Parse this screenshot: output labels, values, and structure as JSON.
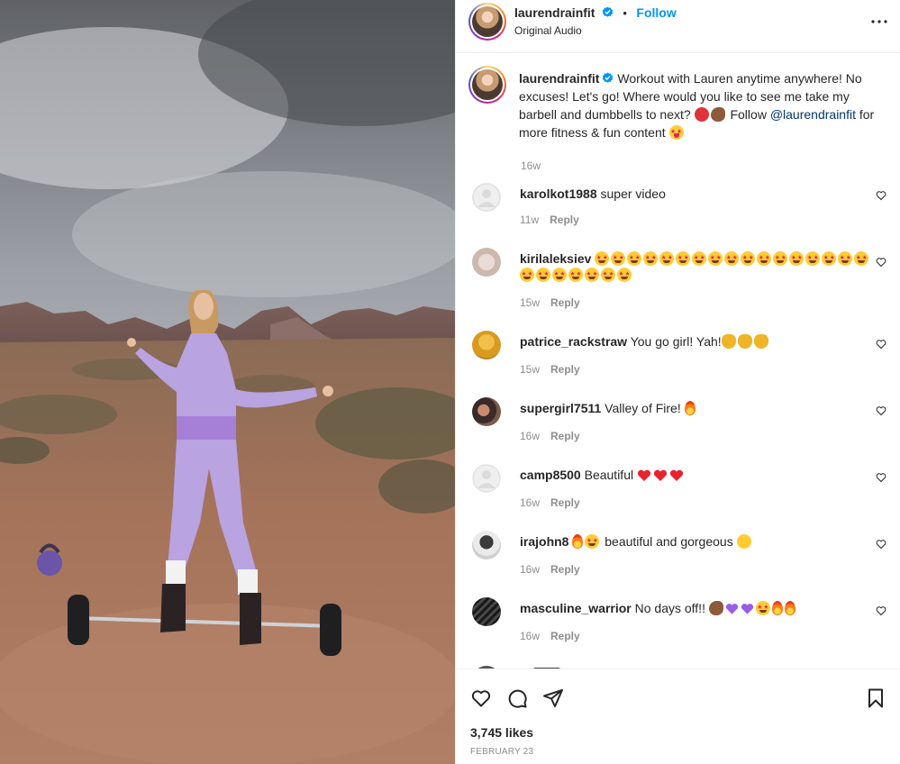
{
  "header": {
    "username": "laurendrainfit",
    "verified": true,
    "separator": "•",
    "follow_label": "Follow",
    "audio_label": "Original Audio",
    "more_icon": "more-horizontal-icon"
  },
  "caption": {
    "username": "laurendrainfit",
    "text_before": "Workout with Lauren anytime anywhere! No excuses! Let's go! Where would you like to see me take my barbell and dumbbells to next?",
    "text_middle": "Follow",
    "mention": "@laurendrainfit",
    "text_after": "for more fitness & fun content",
    "time": "16w"
  },
  "comments": [
    {
      "username": "karolkot1988",
      "text": "super video",
      "time": "11w",
      "reply_label": "Reply",
      "avatar": "default"
    },
    {
      "username": "kirilaleksiev",
      "text": "",
      "emoji": "star-struck x 24",
      "time": "15w",
      "reply_label": "Reply",
      "avatar": "sketch"
    },
    {
      "username": "patrice_rackstraw",
      "text": "You go girl! Yah!",
      "emoji": "raising-hands x 3",
      "time": "15w",
      "reply_label": "Reply",
      "avatar": "yellow"
    },
    {
      "username": "supergirl7511",
      "text": "Valley of Fire!",
      "emoji": "fire",
      "time": "16w",
      "reply_label": "Reply",
      "avatar": "photo"
    },
    {
      "username": "camp8500",
      "text": "Beautiful",
      "emoji": "red-heart x 3",
      "time": "16w",
      "reply_label": "Reply",
      "avatar": "default"
    },
    {
      "username": "irajohn8",
      "text": "beautiful and gorgeous",
      "emoji": "fire, star-struck, winking-kiss",
      "time": "16w",
      "reply_label": "Reply",
      "avatar": "photo"
    },
    {
      "username": "masculine_warrior",
      "text": "No days off!!",
      "emoji": "muscle, purple-heart x 2, star-struck, fire x 2",
      "time": "16w",
      "reply_label": "Reply",
      "avatar": "dark"
    }
  ],
  "footer": {
    "likes": "3,745 likes",
    "date": "FEBRUARY 23",
    "icons": [
      "heart-icon",
      "comment-icon",
      "share-icon",
      "bookmark-icon"
    ]
  },
  "colors": {
    "link_blue": "#0095f6",
    "mention_blue": "#00376b",
    "muted": "#8e8e8e",
    "text": "#262626",
    "outfit_lavender": "#b9a3e0"
  }
}
